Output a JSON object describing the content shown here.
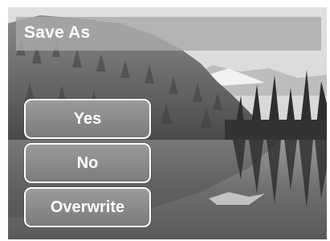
{
  "dialog": {
    "title": "Save As",
    "options": [
      "Yes",
      "No",
      "Overwrite"
    ]
  },
  "background": {
    "description_icon": "lake-forest-photo"
  }
}
